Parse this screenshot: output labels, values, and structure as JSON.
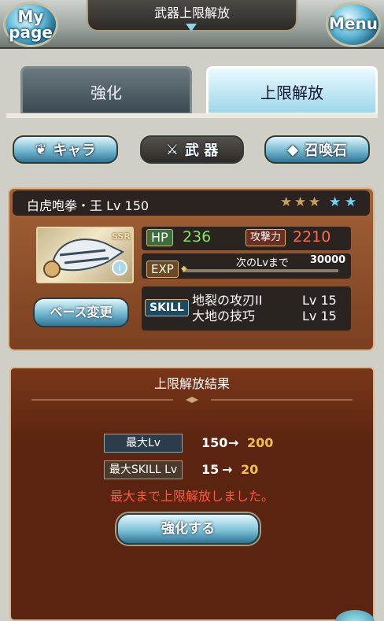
{
  "header": {
    "title": "武器上限解放",
    "mypage_label": "My\npage",
    "menu_label": "Menu"
  },
  "tabs": {
    "enhance": "強化",
    "limit_break": "上限解放"
  },
  "categories": {
    "chara": "キャラ",
    "weapon": "武 器",
    "summon": "召喚石"
  },
  "weapon": {
    "name": "白虎咆拳・王 Lv 150",
    "rarity": "SSR",
    "stars_filled": 3,
    "stars_total": 5,
    "hp_label": "HP",
    "hp": "236",
    "atk_label": "攻撃力",
    "atk": "2210",
    "exp_label": "EXP",
    "next_label": "次のLvまで",
    "next_value": "30000",
    "base_change": "ベース変更",
    "skill_label": "SKILL",
    "skills": [
      {
        "name": "地裂の攻刃II",
        "lv": "Lv 15"
      },
      {
        "name": "大地の技巧",
        "lv": "Lv 15"
      }
    ]
  },
  "result": {
    "title": "上限解放結果",
    "max_lv_label": "最大Lv",
    "max_lv_old": "150",
    "max_lv_new": "200",
    "max_skill_label": "最大SKILL Lv",
    "max_skill_old": "15",
    "max_skill_new": "20",
    "arrow": "→",
    "message": "最大まで上限解放しました。",
    "button": "強化する"
  },
  "colors": {
    "accent_blue": "#73b7cf",
    "panel_brown": "#7a3f1f",
    "hp_green": "#88e060",
    "atk_red": "#ff6a4a",
    "gold": "#f2c04a"
  }
}
